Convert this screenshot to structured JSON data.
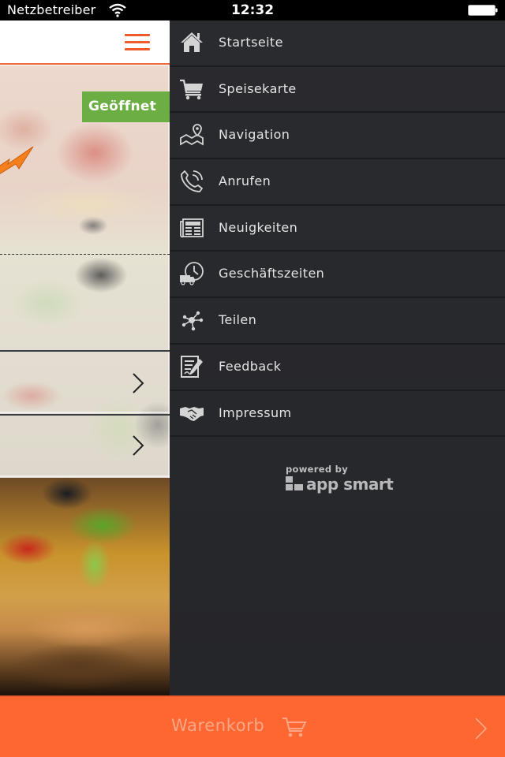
{
  "status_bar": {
    "carrier": "Netzbetreiber",
    "time": "12:32",
    "wifi_icon": "wifi-icon",
    "battery_icon": "battery-icon"
  },
  "app": {
    "menu_icon": "hamburger-icon",
    "open_status": "Geöffnet",
    "colors": {
      "accent": "#fe6732",
      "open_badge": "#6cae44",
      "menu_bg": "#28292d"
    }
  },
  "menu": {
    "items": [
      {
        "label": "Startseite",
        "icon": "home-icon"
      },
      {
        "label": "Speisekarte",
        "icon": "cart-icon"
      },
      {
        "label": "Navigation",
        "icon": "map-pin-icon"
      },
      {
        "label": "Anrufen",
        "icon": "phone-icon"
      },
      {
        "label": "Neuigkeiten",
        "icon": "newspaper-icon"
      },
      {
        "label": "Geschäftszeiten",
        "icon": "delivery-clock-icon"
      },
      {
        "label": "Teilen",
        "icon": "share-icon"
      },
      {
        "label": "Feedback",
        "icon": "feedback-icon"
      },
      {
        "label": "Impressum",
        "icon": "handshake-icon"
      }
    ],
    "powered_by": "powered by",
    "brand": "app smart"
  },
  "cart_bar": {
    "label": "Warenkorb",
    "icon": "shopping-cart-icon",
    "chevron_icon": "chevron-right-icon"
  }
}
